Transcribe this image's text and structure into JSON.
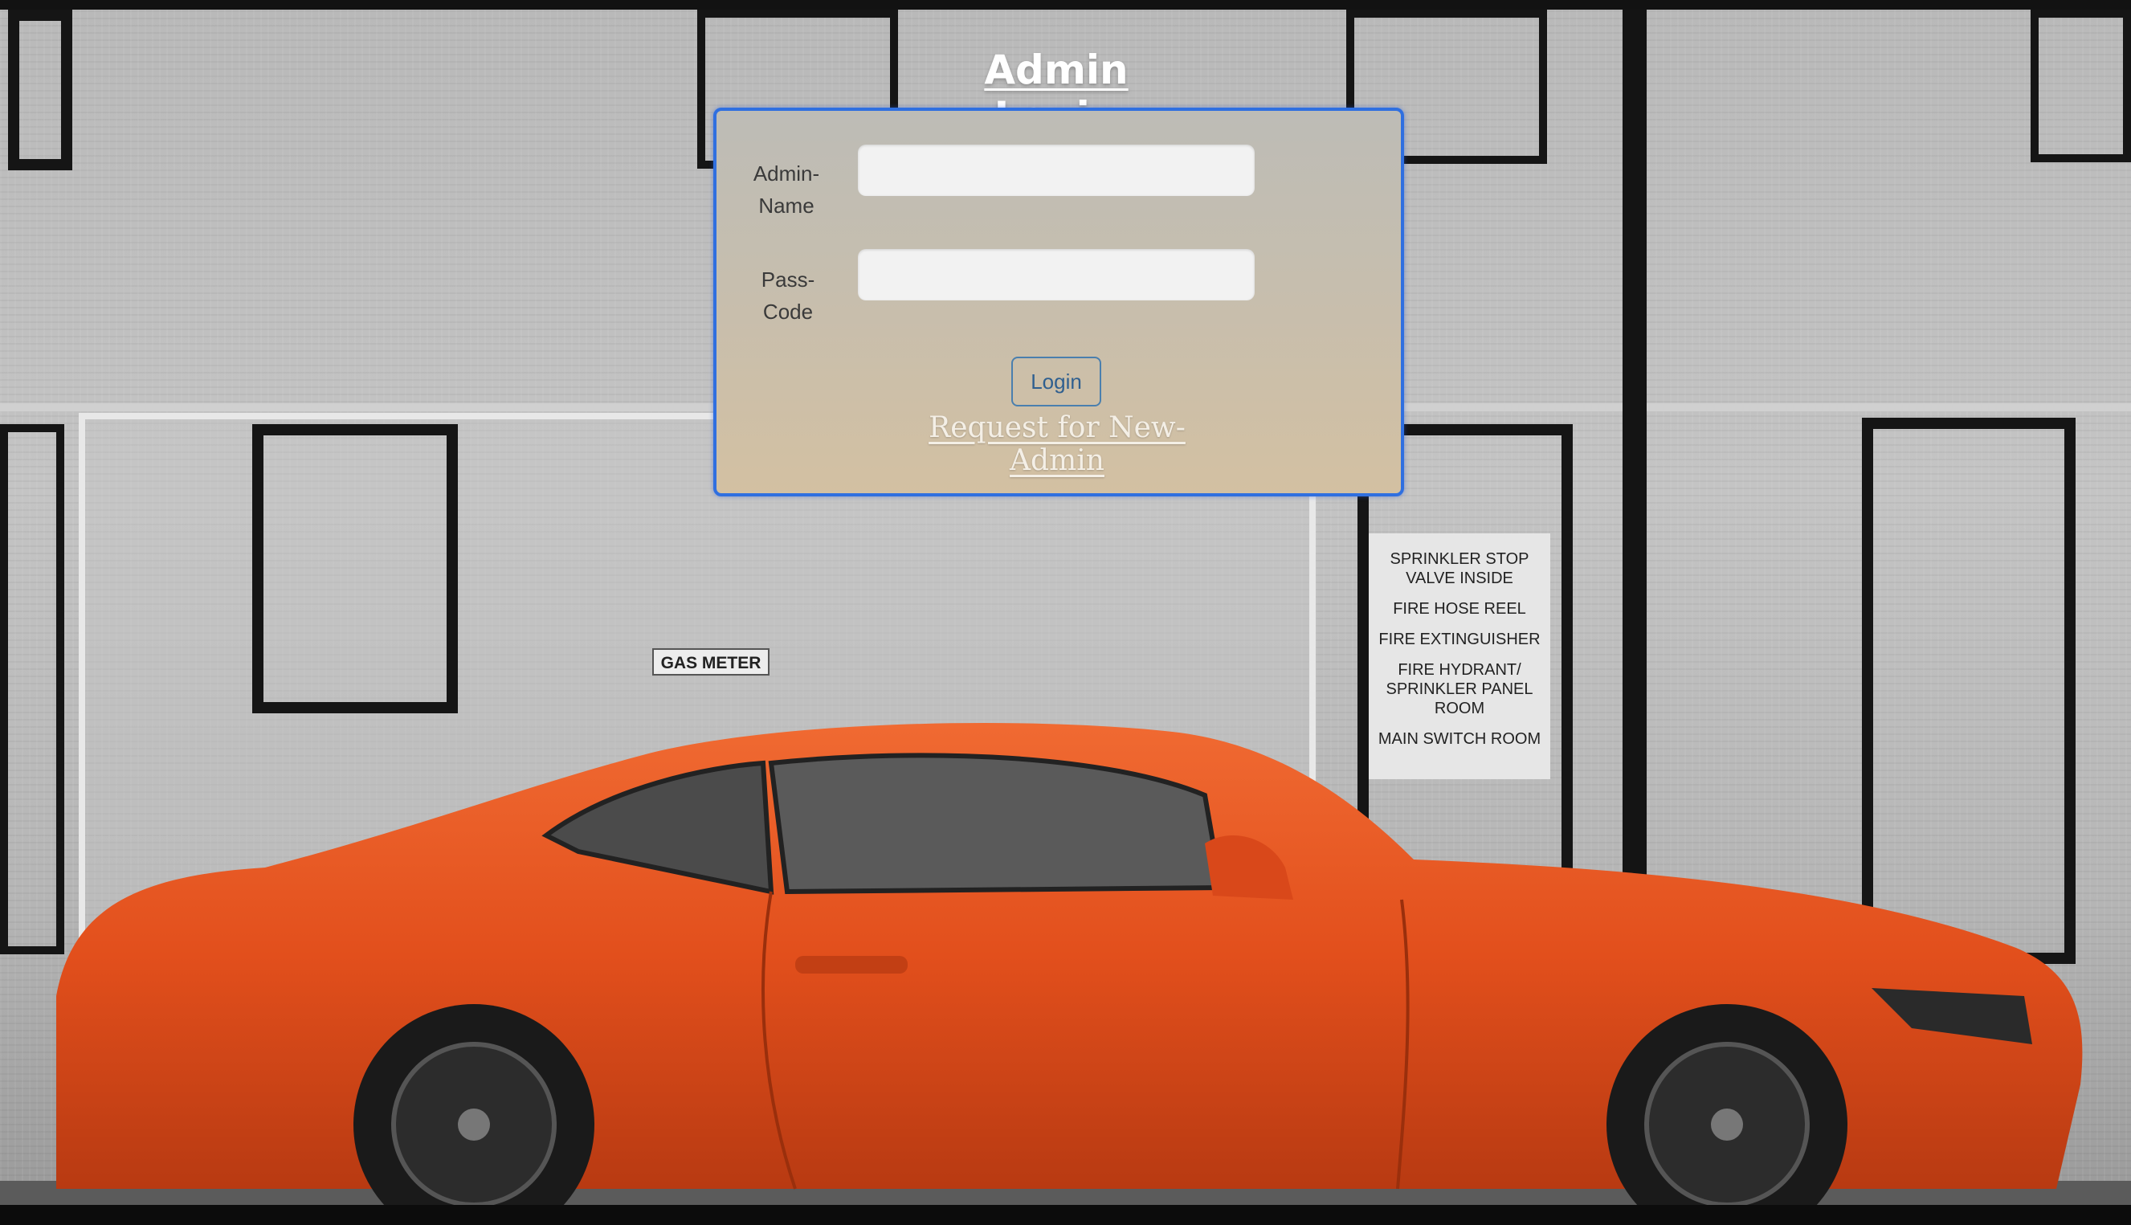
{
  "page": {
    "title": "Admin Login"
  },
  "form": {
    "admin_name_label": "Admin-\nName",
    "admin_name_value": "",
    "pass_code_label": "Pass-\nCode",
    "pass_code_value": "",
    "login_button": "Login",
    "request_link": "Request for New-Admin"
  },
  "background": {
    "gas_meter_sign": "GAS METER",
    "notice_sign": [
      "SPRINKLER STOP VALVE INSIDE",
      "FIRE HOSE REEL",
      "FIRE EXTINGUISHER",
      "FIRE HYDRANT/ SPRINKLER PANEL ROOM",
      "MAIN SWITCH ROOM"
    ]
  },
  "colors": {
    "box_border": "#2f6fe0",
    "car_body": "#e8521f",
    "title_text": "#ffffff"
  }
}
